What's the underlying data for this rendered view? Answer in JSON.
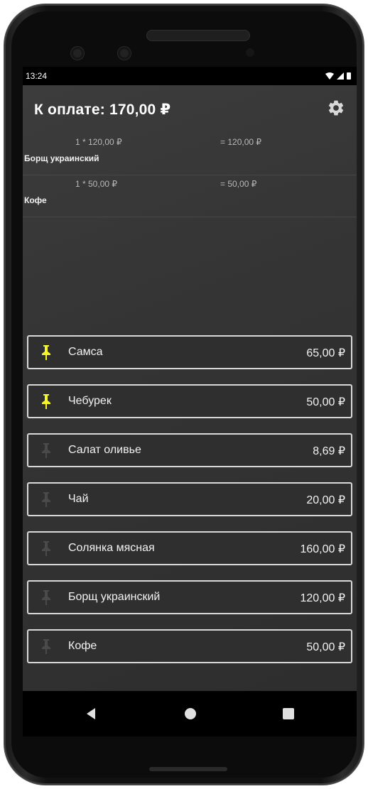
{
  "status_bar": {
    "time": "13:24",
    "icons": [
      "wifi-icon",
      "signal-icon",
      "battery-icon"
    ]
  },
  "header": {
    "title": "К оплате: 170,00 ₽",
    "settings_icon": "gear-icon"
  },
  "order_items": [
    {
      "calc": "1 * 120,00 ₽",
      "sum": "= 120,00 ₽",
      "name": "Борщ украинский"
    },
    {
      "calc": "1 * 50,00 ₽",
      "sum": "= 50,00 ₽",
      "name": "Кофе"
    }
  ],
  "menu_items": [
    {
      "name": "Самса",
      "price": "65,00 ₽",
      "pinned": true
    },
    {
      "name": "Чебурек",
      "price": "50,00 ₽",
      "pinned": true
    },
    {
      "name": "Салат оливье",
      "price": "8,69 ₽",
      "pinned": false
    },
    {
      "name": "Чай",
      "price": "20,00 ₽",
      "pinned": false
    },
    {
      "name": "Солянка мясная",
      "price": "160,00 ₽",
      "pinned": false
    },
    {
      "name": "Борщ украинский",
      "price": "120,00 ₽",
      "pinned": false
    },
    {
      "name": "Кофе",
      "price": "50,00 ₽",
      "pinned": false
    }
  ],
  "colors": {
    "pin_active": "#f5f52a",
    "pin_inactive": "#4a4a4a",
    "background": "#303030"
  },
  "nav_bar": {
    "buttons": [
      "back-icon",
      "home-icon",
      "recents-icon"
    ]
  }
}
